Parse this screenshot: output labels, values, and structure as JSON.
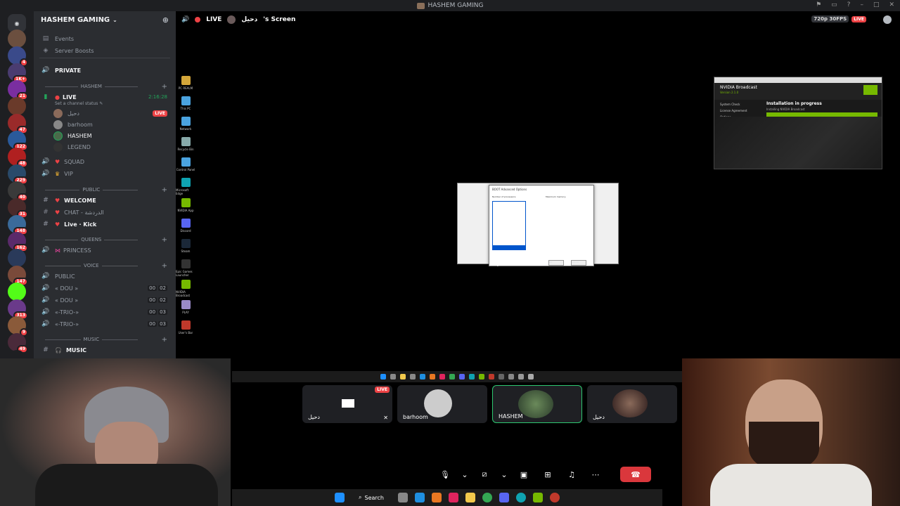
{
  "window": {
    "title": "HASHEM GAMING"
  },
  "server": {
    "name": "HASHEM GAMING"
  },
  "servers": [
    {
      "color": "#6b4f3f",
      "badge": ""
    },
    {
      "color": "#3a4a8a",
      "badge": "4"
    },
    {
      "color": "#4a3c70",
      "badge": "1K+"
    },
    {
      "color": "#7a2ea0",
      "badge": "21"
    },
    {
      "color": "#6a3a2a",
      "badge": ""
    },
    {
      "color": "#9a2a2a",
      "badge": "47"
    },
    {
      "color": "#2a5a9a",
      "badge": "122"
    },
    {
      "color": "#b02020",
      "badge": "48"
    },
    {
      "color": "#2a4a6a",
      "badge": "229"
    },
    {
      "color": "#3a3a3a",
      "badge": "40"
    },
    {
      "color": "#4a2a2a",
      "badge": "31"
    },
    {
      "color": "#3a6a9a",
      "badge": "148"
    },
    {
      "color": "#5a2a6a",
      "badge": "162"
    },
    {
      "color": "#2a3a5a",
      "badge": ""
    },
    {
      "color": "#7a4a3a",
      "badge": "147"
    },
    {
      "color": "#53fc18",
      "badge": ""
    },
    {
      "color": "#6a3a8a",
      "badge": "313"
    },
    {
      "color": "#8a5a3a",
      "badge": "9"
    },
    {
      "color": "#4a2a3a",
      "badge": "49"
    },
    {
      "color": "#1e1f22",
      "badge": ""
    }
  ],
  "channels": {
    "events": "Events",
    "boosts": "Server Boosts",
    "private": "PRIVATE",
    "cat_hashem": "HASHEM",
    "live": "LIVE",
    "live_time": "2:16:28",
    "status": "Set a channel status",
    "users": [
      {
        "name": "دحيل",
        "live": "LIVE"
      },
      {
        "name": "barhoom"
      },
      {
        "name": "HASHEM"
      },
      {
        "name": "LEGEND"
      }
    ],
    "squad": "SQUAD",
    "vip": "VIP",
    "cat_public": "PUBLIC",
    "welcome": "WELCOME",
    "chat": "CHAT - الدردشة",
    "live_kick": "Live · Kick",
    "cat_queens": "QUEENS",
    "princess": "PRINCESS",
    "cat_voice": "VOICE",
    "public_voice": "PUBLIC",
    "dou1": "« DOU »",
    "dou1_a": "00",
    "dou1_b": "02",
    "dou2": "« DOU »",
    "dou2_a": "00",
    "dou2_b": "02",
    "trio1": "«-TRIO-»",
    "trio1_a": "00",
    "trio1_b": "03",
    "trio2": "«-TRIO-»",
    "trio2_a": "00",
    "trio2_b": "03",
    "cat_music": "MUSIC",
    "music": "MUSIC"
  },
  "stream": {
    "live": "LIVE",
    "screen_title": "'s Screen",
    "owner": "دحيل",
    "quality": "720p 30FPS",
    "quality_live": "LIVE"
  },
  "desktop_icons": [
    "PC REALM",
    "This PC",
    "Network",
    "Recycle Bin",
    "Control Panel",
    "Microsoft Edge",
    "NVIDIA App",
    "Discord",
    "Steam",
    "Epic Games Launcher",
    "NVIDIA Broadcast",
    "PLAY",
    "User's Bar"
  ],
  "nvidia": {
    "title": "NVIDIA Broadcast",
    "version": "Version 2.1.0",
    "heading": "Installation in progress",
    "sub": "Installing NVIDIA Broadcast",
    "steps": [
      "System Check",
      "License Agreement",
      "Options",
      "Install",
      "Finish"
    ],
    "progress": 1.0
  },
  "dialog": {
    "title": "BOOT Advanced Options",
    "field1": "Number of processors:",
    "field2": "Maximum memory:",
    "ok": "OK",
    "cancel": "Cancel"
  },
  "tiles": [
    {
      "name": "دحيل",
      "live": "LIVE"
    },
    {
      "name": "barhoom"
    },
    {
      "name": "HASHEM"
    },
    {
      "name": "دحيل"
    }
  ],
  "taskbar": {
    "search": "Search"
  }
}
